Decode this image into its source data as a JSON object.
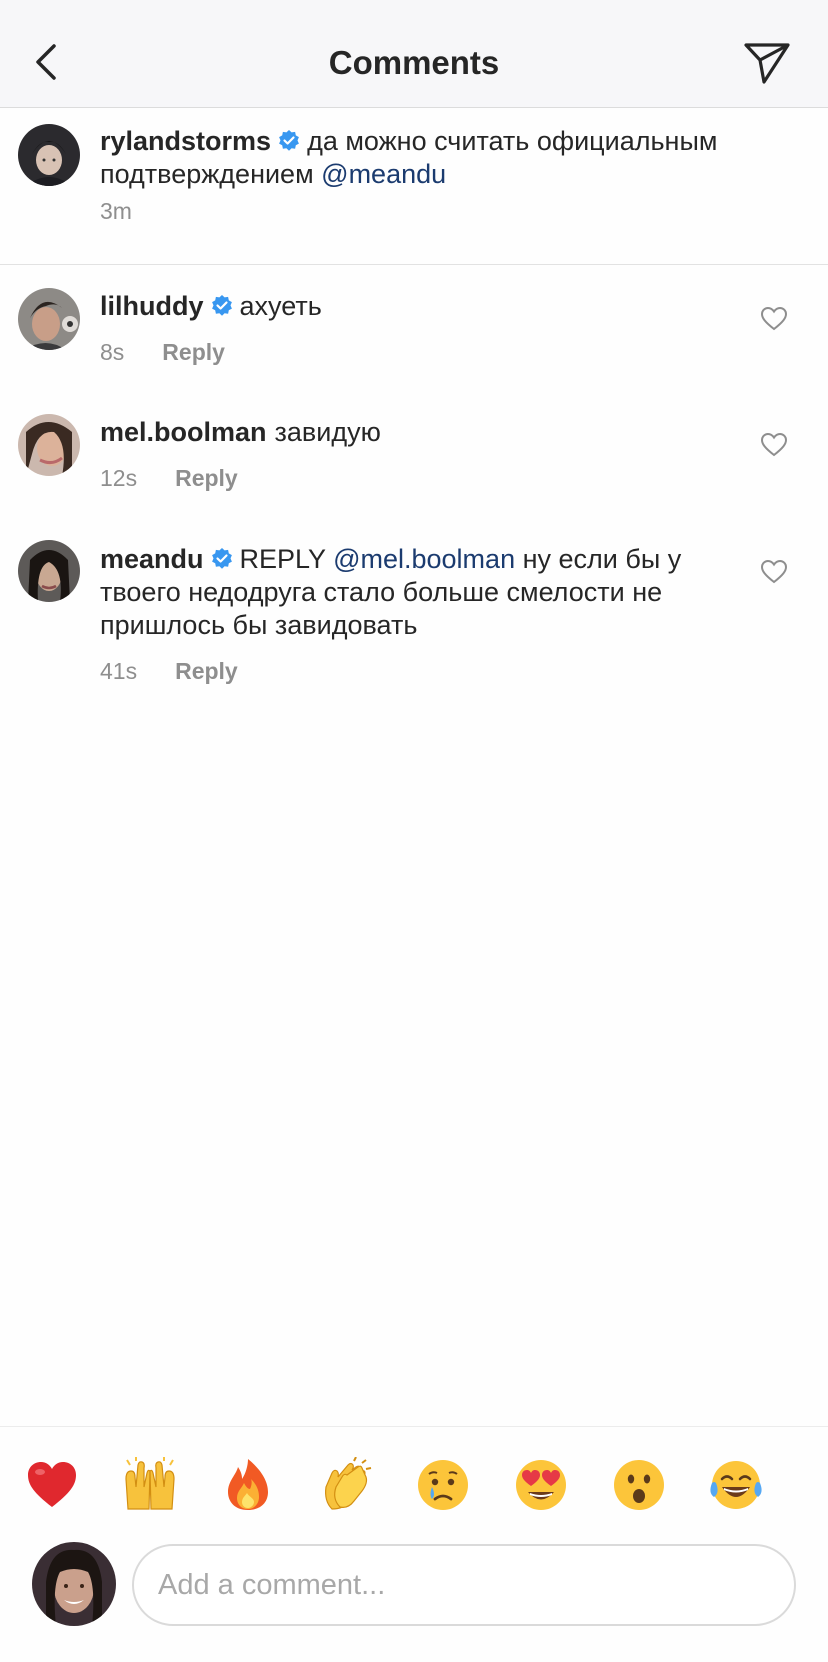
{
  "header": {
    "title": "Comments",
    "back_icon": "chevron-left-icon",
    "send_icon": "paper-plane-icon"
  },
  "caption": {
    "username": "rylandstorms",
    "verified": true,
    "text_before": "да можно считать официальным подтверждением ",
    "mention": "@meandu",
    "time": "3m"
  },
  "comments": [
    {
      "username": "lilhuddy",
      "verified": true,
      "prefix": "",
      "mention": "",
      "text": "ахуеть",
      "time": "8s",
      "reply_label": "Reply"
    },
    {
      "username": "mel.boolman",
      "verified": false,
      "prefix": "",
      "mention": "",
      "text": "завидую",
      "time": "12s",
      "reply_label": "Reply"
    },
    {
      "username": "meandu",
      "verified": true,
      "prefix": "REPLY ",
      "mention": "@mel.boolman",
      "text": " ну если бы у твоего недодруга стало больше смелости не пришлось бы завидовать",
      "time": "41s",
      "reply_label": "Reply"
    }
  ],
  "emoji_bar": [
    {
      "name": "red-heart",
      "glyph": "❤️"
    },
    {
      "name": "raising-hands",
      "glyph": "🙌"
    },
    {
      "name": "fire",
      "glyph": "🔥"
    },
    {
      "name": "clapping-hands",
      "glyph": "👏"
    },
    {
      "name": "crying-face",
      "glyph": "😢"
    },
    {
      "name": "heart-eyes",
      "glyph": "😍"
    },
    {
      "name": "surprised-face",
      "glyph": "😮"
    },
    {
      "name": "tears-of-joy",
      "glyph": "😂"
    }
  ],
  "composer": {
    "placeholder": "Add a comment..."
  },
  "colors": {
    "verified_blue": "#3897f0",
    "mention": "#1b3b6f",
    "meta_gray": "#8e8e8e"
  }
}
